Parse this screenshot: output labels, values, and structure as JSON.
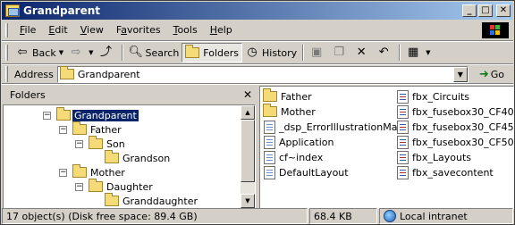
{
  "window": {
    "title": "Grandparent",
    "min": "_",
    "max": "□",
    "close": "✕"
  },
  "menu": [
    {
      "first": "F",
      "rest": "ile"
    },
    {
      "first": "E",
      "rest": "dit"
    },
    {
      "first": "V",
      "rest": "iew"
    },
    {
      "first": "",
      "rest": "Favorites",
      "underline_index": 1
    },
    {
      "first": "T",
      "rest": "ools"
    },
    {
      "first": "H",
      "rest": "elp"
    }
  ],
  "toolbar": {
    "back": "Back",
    "search": "Search",
    "folders": "Folders",
    "history": "History"
  },
  "address": {
    "label": "Address",
    "value": "Grandparent",
    "go": "Go"
  },
  "folders_pane": {
    "title": "Folders",
    "close": "✕",
    "tree": [
      {
        "label": "Grandparent",
        "depth": 0,
        "toggle": "−",
        "selected": true
      },
      {
        "label": "Father",
        "depth": 1,
        "toggle": "−"
      },
      {
        "label": "Son",
        "depth": 2,
        "toggle": "−"
      },
      {
        "label": "Grandson",
        "depth": 3,
        "toggle": ""
      },
      {
        "label": "Mother",
        "depth": 1,
        "toggle": "−"
      },
      {
        "label": "Daughter",
        "depth": 2,
        "toggle": "−"
      },
      {
        "label": "Granddaughter",
        "depth": 3,
        "toggle": ""
      }
    ]
  },
  "files": {
    "left_column": [
      {
        "name": "Father",
        "type": "folder"
      },
      {
        "name": "Mother",
        "type": "folder"
      },
      {
        "name": "_dsp_ErrorIllustrationMain",
        "type": "file"
      },
      {
        "name": "Application",
        "type": "file"
      },
      {
        "name": "cf~index",
        "type": "file"
      },
      {
        "name": "DefaultLayout",
        "type": "file"
      }
    ],
    "right_column": [
      {
        "name": "fbx_Circuits",
        "type": "fbx"
      },
      {
        "name": "fbx_fusebox30_CF40",
        "type": "fbx"
      },
      {
        "name": "fbx_fusebox30_CF45",
        "type": "fbx"
      },
      {
        "name": "fbx_fusebox30_CF50",
        "type": "fbx"
      },
      {
        "name": "fbx_Layouts",
        "type": "fbx"
      },
      {
        "name": "fbx_savecontent",
        "type": "fbx"
      }
    ]
  },
  "status": {
    "objects": "17 object(s) (Disk free space: 89.4 GB)",
    "size": "68.4 KB",
    "zone": "Local intranet"
  }
}
